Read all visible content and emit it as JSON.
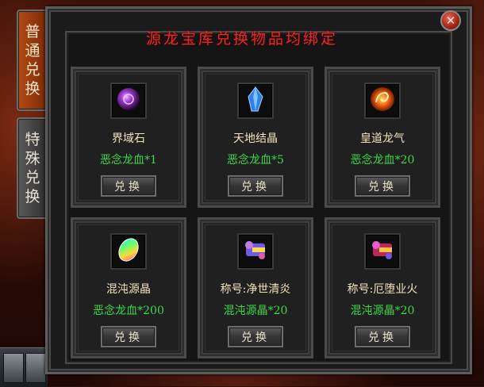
{
  "header": {
    "title": "源龙宝库兑换物品均绑定",
    "close_icon": "close-icon"
  },
  "tabs": [
    {
      "label": "普\n通\n兑\n换",
      "active": true
    },
    {
      "label": "特\n殊\n兑\n换",
      "active": false
    }
  ],
  "items": [
    {
      "name": "界域石",
      "cost": "恶念龙血*1",
      "button": "兑换",
      "icon": "purple-orb-icon"
    },
    {
      "name": "天地结晶",
      "cost": "恶念龙血*5",
      "button": "兑换",
      "icon": "blue-crystal-icon"
    },
    {
      "name": "皇道龙气",
      "cost": "恶念龙血*20",
      "button": "兑换",
      "icon": "fire-swirl-icon"
    },
    {
      "name": "混沌源晶",
      "cost": "恶念龙血*200",
      "button": "兑换",
      "icon": "rainbow-gem-icon"
    },
    {
      "name": "称号:净世清炎",
      "cost": "混沌源晶*20",
      "button": "兑换",
      "icon": "blue-title-scroll-icon"
    },
    {
      "name": "称号:厄堕业火",
      "cost": "混沌源晶*20",
      "button": "兑换",
      "icon": "red-title-scroll-icon"
    }
  ],
  "colors": {
    "title": "#e82a2a",
    "cost": "#3ed84a",
    "name": "#f2e3bd"
  }
}
